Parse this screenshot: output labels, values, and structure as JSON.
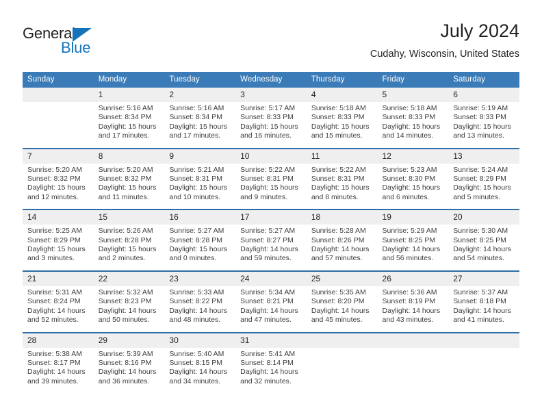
{
  "brand": {
    "name_dark": "General",
    "name_blue": "Blue",
    "accent_color": "#1573ba"
  },
  "header": {
    "title": "July 2024",
    "subtitle": "Cudahy, Wisconsin, United States"
  },
  "theme": {
    "header_bg": "#3b7cb8",
    "daynum_bg": "#efefef",
    "week_divider": "#2d6ca8",
    "text": "#231f20"
  },
  "labels": {
    "sunrise": "Sunrise:",
    "sunset": "Sunset:",
    "daylight": "Daylight:"
  },
  "weekday_headers": [
    "Sunday",
    "Monday",
    "Tuesday",
    "Wednesday",
    "Thursday",
    "Friday",
    "Saturday"
  ],
  "weeks": [
    [
      {
        "day": "",
        "sunrise": "",
        "sunset": "",
        "daylight": ""
      },
      {
        "day": "1",
        "sunrise": "Sunrise: 5:16 AM",
        "sunset": "Sunset: 8:34 PM",
        "daylight": "Daylight: 15 hours and 17 minutes."
      },
      {
        "day": "2",
        "sunrise": "Sunrise: 5:16 AM",
        "sunset": "Sunset: 8:34 PM",
        "daylight": "Daylight: 15 hours and 17 minutes."
      },
      {
        "day": "3",
        "sunrise": "Sunrise: 5:17 AM",
        "sunset": "Sunset: 8:33 PM",
        "daylight": "Daylight: 15 hours and 16 minutes."
      },
      {
        "day": "4",
        "sunrise": "Sunrise: 5:18 AM",
        "sunset": "Sunset: 8:33 PM",
        "daylight": "Daylight: 15 hours and 15 minutes."
      },
      {
        "day": "5",
        "sunrise": "Sunrise: 5:18 AM",
        "sunset": "Sunset: 8:33 PM",
        "daylight": "Daylight: 15 hours and 14 minutes."
      },
      {
        "day": "6",
        "sunrise": "Sunrise: 5:19 AM",
        "sunset": "Sunset: 8:33 PM",
        "daylight": "Daylight: 15 hours and 13 minutes."
      }
    ],
    [
      {
        "day": "7",
        "sunrise": "Sunrise: 5:20 AM",
        "sunset": "Sunset: 8:32 PM",
        "daylight": "Daylight: 15 hours and 12 minutes."
      },
      {
        "day": "8",
        "sunrise": "Sunrise: 5:20 AM",
        "sunset": "Sunset: 8:32 PM",
        "daylight": "Daylight: 15 hours and 11 minutes."
      },
      {
        "day": "9",
        "sunrise": "Sunrise: 5:21 AM",
        "sunset": "Sunset: 8:31 PM",
        "daylight": "Daylight: 15 hours and 10 minutes."
      },
      {
        "day": "10",
        "sunrise": "Sunrise: 5:22 AM",
        "sunset": "Sunset: 8:31 PM",
        "daylight": "Daylight: 15 hours and 9 minutes."
      },
      {
        "day": "11",
        "sunrise": "Sunrise: 5:22 AM",
        "sunset": "Sunset: 8:31 PM",
        "daylight": "Daylight: 15 hours and 8 minutes."
      },
      {
        "day": "12",
        "sunrise": "Sunrise: 5:23 AM",
        "sunset": "Sunset: 8:30 PM",
        "daylight": "Daylight: 15 hours and 6 minutes."
      },
      {
        "day": "13",
        "sunrise": "Sunrise: 5:24 AM",
        "sunset": "Sunset: 8:29 PM",
        "daylight": "Daylight: 15 hours and 5 minutes."
      }
    ],
    [
      {
        "day": "14",
        "sunrise": "Sunrise: 5:25 AM",
        "sunset": "Sunset: 8:29 PM",
        "daylight": "Daylight: 15 hours and 3 minutes."
      },
      {
        "day": "15",
        "sunrise": "Sunrise: 5:26 AM",
        "sunset": "Sunset: 8:28 PM",
        "daylight": "Daylight: 15 hours and 2 minutes."
      },
      {
        "day": "16",
        "sunrise": "Sunrise: 5:27 AM",
        "sunset": "Sunset: 8:28 PM",
        "daylight": "Daylight: 15 hours and 0 minutes."
      },
      {
        "day": "17",
        "sunrise": "Sunrise: 5:27 AM",
        "sunset": "Sunset: 8:27 PM",
        "daylight": "Daylight: 14 hours and 59 minutes."
      },
      {
        "day": "18",
        "sunrise": "Sunrise: 5:28 AM",
        "sunset": "Sunset: 8:26 PM",
        "daylight": "Daylight: 14 hours and 57 minutes."
      },
      {
        "day": "19",
        "sunrise": "Sunrise: 5:29 AM",
        "sunset": "Sunset: 8:25 PM",
        "daylight": "Daylight: 14 hours and 56 minutes."
      },
      {
        "day": "20",
        "sunrise": "Sunrise: 5:30 AM",
        "sunset": "Sunset: 8:25 PM",
        "daylight": "Daylight: 14 hours and 54 minutes."
      }
    ],
    [
      {
        "day": "21",
        "sunrise": "Sunrise: 5:31 AM",
        "sunset": "Sunset: 8:24 PM",
        "daylight": "Daylight: 14 hours and 52 minutes."
      },
      {
        "day": "22",
        "sunrise": "Sunrise: 5:32 AM",
        "sunset": "Sunset: 8:23 PM",
        "daylight": "Daylight: 14 hours and 50 minutes."
      },
      {
        "day": "23",
        "sunrise": "Sunrise: 5:33 AM",
        "sunset": "Sunset: 8:22 PM",
        "daylight": "Daylight: 14 hours and 48 minutes."
      },
      {
        "day": "24",
        "sunrise": "Sunrise: 5:34 AM",
        "sunset": "Sunset: 8:21 PM",
        "daylight": "Daylight: 14 hours and 47 minutes."
      },
      {
        "day": "25",
        "sunrise": "Sunrise: 5:35 AM",
        "sunset": "Sunset: 8:20 PM",
        "daylight": "Daylight: 14 hours and 45 minutes."
      },
      {
        "day": "26",
        "sunrise": "Sunrise: 5:36 AM",
        "sunset": "Sunset: 8:19 PM",
        "daylight": "Daylight: 14 hours and 43 minutes."
      },
      {
        "day": "27",
        "sunrise": "Sunrise: 5:37 AM",
        "sunset": "Sunset: 8:18 PM",
        "daylight": "Daylight: 14 hours and 41 minutes."
      }
    ],
    [
      {
        "day": "28",
        "sunrise": "Sunrise: 5:38 AM",
        "sunset": "Sunset: 8:17 PM",
        "daylight": "Daylight: 14 hours and 39 minutes."
      },
      {
        "day": "29",
        "sunrise": "Sunrise: 5:39 AM",
        "sunset": "Sunset: 8:16 PM",
        "daylight": "Daylight: 14 hours and 36 minutes."
      },
      {
        "day": "30",
        "sunrise": "Sunrise: 5:40 AM",
        "sunset": "Sunset: 8:15 PM",
        "daylight": "Daylight: 14 hours and 34 minutes."
      },
      {
        "day": "31",
        "sunrise": "Sunrise: 5:41 AM",
        "sunset": "Sunset: 8:14 PM",
        "daylight": "Daylight: 14 hours and 32 minutes."
      },
      {
        "day": "",
        "sunrise": "",
        "sunset": "",
        "daylight": ""
      },
      {
        "day": "",
        "sunrise": "",
        "sunset": "",
        "daylight": ""
      },
      {
        "day": "",
        "sunrise": "",
        "sunset": "",
        "daylight": ""
      }
    ]
  ]
}
